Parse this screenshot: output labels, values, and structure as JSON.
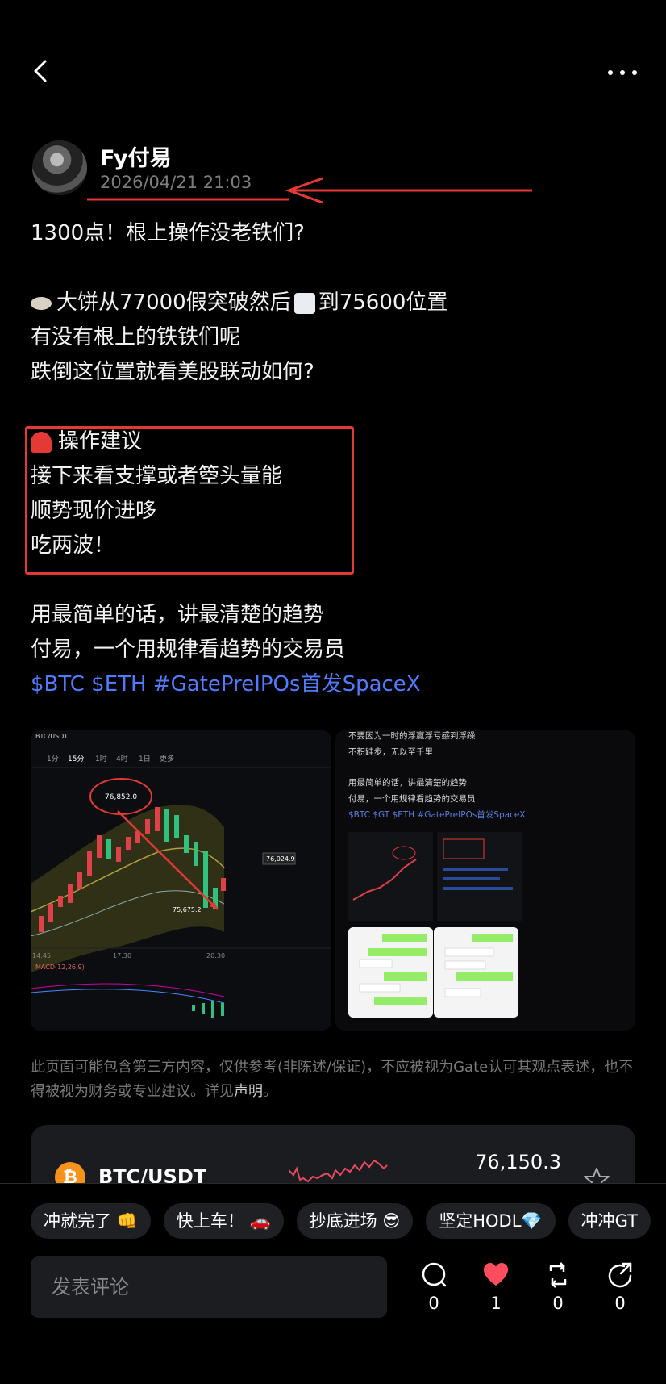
{
  "header": {
    "back_icon": "chevron-left-icon",
    "more_icon": "ellipsis-icon"
  },
  "author": {
    "name": "Fy付易",
    "time": "2026/04/21 21:03"
  },
  "post": {
    "line1": "1300点！根上操作没老铁们?",
    "line2": "大饼从77000假突破然后",
    "line2b": "到75600位置",
    "line3": "有没有根上的铁铁们呢",
    "line4": "跌倒这位置就看美股联动如何?",
    "advice_title": "操作建议",
    "advice1": "接下来看支撑或者箜头量能",
    "advice2": "顺势现价进哆",
    "advice3": "吃两波！",
    "slogan1": "用最简单的话，讲最清楚的趋势",
    "slogan2": "付易，一个用规律看趋势的交易员",
    "tags": "$BTC $ETH #GatePreIPOs首发SpaceX"
  },
  "chart_image": {
    "pair": "BTC/USDT",
    "tabs": [
      "1分",
      "15分",
      "1时",
      "4时",
      "1日",
      "更多"
    ],
    "high_label": "76,852.0",
    "low_label": "75,675.2",
    "price_tag": "76,024.9",
    "times": [
      "14:45",
      "17:30",
      "20:30"
    ],
    "macd_label": "MACD(12,26,9)"
  },
  "screenshot_image": {
    "line1": "不要因为一时的浮赢浮亏感到浮躁",
    "line2": "不积跬步，无以至千里",
    "line3": "用最简单的话，讲最清楚的趋势",
    "line4": "付易，一个用规律看趋势的交易员",
    "line5": "$BTC $GT $ETH #GatePreIPOs首发SpaceX"
  },
  "disclaimer": {
    "text": "此页面可能包含第三方内容，仅供参考(非陈述/保证)，不应被视为Gate认可其观点表述，也不得被视为财务或专业建议。详见",
    "link": "声明",
    "end": "。"
  },
  "ticker": {
    "icon": "bitcoin-icon",
    "pair": "BTC/USDT",
    "price": "76,150.3",
    "trend_color": "#e84a5f"
  },
  "quick_replies": [
    "冲就完了 👊",
    "快上车！ 🚗",
    "抄底进场 😎",
    "坚定HODL💎",
    "冲冲GT"
  ],
  "comment": {
    "placeholder": "发表评论"
  },
  "actions": {
    "comments": "0",
    "likes": "1",
    "reposts": "0",
    "shares": "0"
  },
  "colors": {
    "background": "#000000",
    "accent_link": "#4f7cff",
    "annotation_red": "#e53935",
    "like_red": "#ff4d5e"
  }
}
